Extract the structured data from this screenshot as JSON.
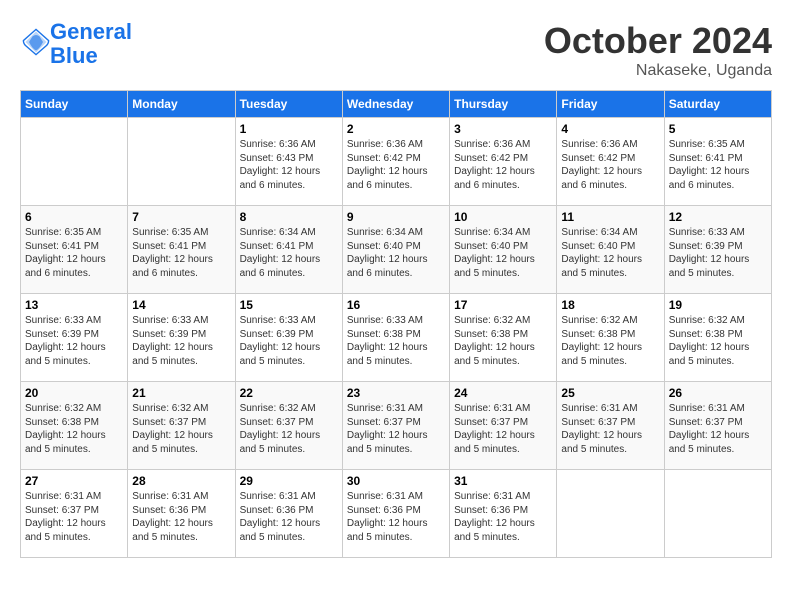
{
  "logo": {
    "line1": "General",
    "line2": "Blue"
  },
  "title": "October 2024",
  "location": "Nakaseke, Uganda",
  "header": {
    "days": [
      "Sunday",
      "Monday",
      "Tuesday",
      "Wednesday",
      "Thursday",
      "Friday",
      "Saturday"
    ]
  },
  "weeks": [
    [
      {
        "day": "",
        "info": ""
      },
      {
        "day": "",
        "info": ""
      },
      {
        "day": "1",
        "info": "Sunrise: 6:36 AM\nSunset: 6:43 PM\nDaylight: 12 hours\nand 6 minutes."
      },
      {
        "day": "2",
        "info": "Sunrise: 6:36 AM\nSunset: 6:42 PM\nDaylight: 12 hours\nand 6 minutes."
      },
      {
        "day": "3",
        "info": "Sunrise: 6:36 AM\nSunset: 6:42 PM\nDaylight: 12 hours\nand 6 minutes."
      },
      {
        "day": "4",
        "info": "Sunrise: 6:36 AM\nSunset: 6:42 PM\nDaylight: 12 hours\nand 6 minutes."
      },
      {
        "day": "5",
        "info": "Sunrise: 6:35 AM\nSunset: 6:41 PM\nDaylight: 12 hours\nand 6 minutes."
      }
    ],
    [
      {
        "day": "6",
        "info": "Sunrise: 6:35 AM\nSunset: 6:41 PM\nDaylight: 12 hours\nand 6 minutes."
      },
      {
        "day": "7",
        "info": "Sunrise: 6:35 AM\nSunset: 6:41 PM\nDaylight: 12 hours\nand 6 minutes."
      },
      {
        "day": "8",
        "info": "Sunrise: 6:34 AM\nSunset: 6:41 PM\nDaylight: 12 hours\nand 6 minutes."
      },
      {
        "day": "9",
        "info": "Sunrise: 6:34 AM\nSunset: 6:40 PM\nDaylight: 12 hours\nand 6 minutes."
      },
      {
        "day": "10",
        "info": "Sunrise: 6:34 AM\nSunset: 6:40 PM\nDaylight: 12 hours\nand 5 minutes."
      },
      {
        "day": "11",
        "info": "Sunrise: 6:34 AM\nSunset: 6:40 PM\nDaylight: 12 hours\nand 5 minutes."
      },
      {
        "day": "12",
        "info": "Sunrise: 6:33 AM\nSunset: 6:39 PM\nDaylight: 12 hours\nand 5 minutes."
      }
    ],
    [
      {
        "day": "13",
        "info": "Sunrise: 6:33 AM\nSunset: 6:39 PM\nDaylight: 12 hours\nand 5 minutes."
      },
      {
        "day": "14",
        "info": "Sunrise: 6:33 AM\nSunset: 6:39 PM\nDaylight: 12 hours\nand 5 minutes."
      },
      {
        "day": "15",
        "info": "Sunrise: 6:33 AM\nSunset: 6:39 PM\nDaylight: 12 hours\nand 5 minutes."
      },
      {
        "day": "16",
        "info": "Sunrise: 6:33 AM\nSunset: 6:38 PM\nDaylight: 12 hours\nand 5 minutes."
      },
      {
        "day": "17",
        "info": "Sunrise: 6:32 AM\nSunset: 6:38 PM\nDaylight: 12 hours\nand 5 minutes."
      },
      {
        "day": "18",
        "info": "Sunrise: 6:32 AM\nSunset: 6:38 PM\nDaylight: 12 hours\nand 5 minutes."
      },
      {
        "day": "19",
        "info": "Sunrise: 6:32 AM\nSunset: 6:38 PM\nDaylight: 12 hours\nand 5 minutes."
      }
    ],
    [
      {
        "day": "20",
        "info": "Sunrise: 6:32 AM\nSunset: 6:38 PM\nDaylight: 12 hours\nand 5 minutes."
      },
      {
        "day": "21",
        "info": "Sunrise: 6:32 AM\nSunset: 6:37 PM\nDaylight: 12 hours\nand 5 minutes."
      },
      {
        "day": "22",
        "info": "Sunrise: 6:32 AM\nSunset: 6:37 PM\nDaylight: 12 hours\nand 5 minutes."
      },
      {
        "day": "23",
        "info": "Sunrise: 6:31 AM\nSunset: 6:37 PM\nDaylight: 12 hours\nand 5 minutes."
      },
      {
        "day": "24",
        "info": "Sunrise: 6:31 AM\nSunset: 6:37 PM\nDaylight: 12 hours\nand 5 minutes."
      },
      {
        "day": "25",
        "info": "Sunrise: 6:31 AM\nSunset: 6:37 PM\nDaylight: 12 hours\nand 5 minutes."
      },
      {
        "day": "26",
        "info": "Sunrise: 6:31 AM\nSunset: 6:37 PM\nDaylight: 12 hours\nand 5 minutes."
      }
    ],
    [
      {
        "day": "27",
        "info": "Sunrise: 6:31 AM\nSunset: 6:37 PM\nDaylight: 12 hours\nand 5 minutes."
      },
      {
        "day": "28",
        "info": "Sunrise: 6:31 AM\nSunset: 6:36 PM\nDaylight: 12 hours\nand 5 minutes."
      },
      {
        "day": "29",
        "info": "Sunrise: 6:31 AM\nSunset: 6:36 PM\nDaylight: 12 hours\nand 5 minutes."
      },
      {
        "day": "30",
        "info": "Sunrise: 6:31 AM\nSunset: 6:36 PM\nDaylight: 12 hours\nand 5 minutes."
      },
      {
        "day": "31",
        "info": "Sunrise: 6:31 AM\nSunset: 6:36 PM\nDaylight: 12 hours\nand 5 minutes."
      },
      {
        "day": "",
        "info": ""
      },
      {
        "day": "",
        "info": ""
      }
    ]
  ]
}
